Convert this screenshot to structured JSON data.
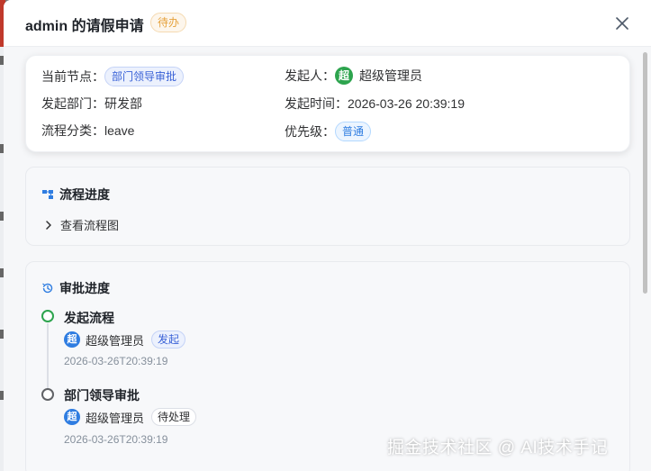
{
  "drawer": {
    "title": "admin 的请假申请",
    "status": "待办",
    "close_icon": "close-icon"
  },
  "info": {
    "node_label": "当前节点：",
    "node_value": "部门领导审批",
    "initiator_label": "发起人：",
    "initiator_avatar": "超",
    "initiator_name": "超级管理员",
    "dept_label": "发起部门：",
    "dept_value": "研发部",
    "time_label": "发起时间：",
    "time_value": "2026-03-26 20:39:19",
    "category_label": "流程分类：",
    "category_value": "leave",
    "priority_label": "优先级：",
    "priority_value": "普通"
  },
  "flow_progress": {
    "title": "流程进度",
    "icon": "flowchart-icon",
    "toggle_label": "查看流程图",
    "toggle_icon": "chevron-right-icon"
  },
  "approval_progress": {
    "title": "审批进度",
    "icon": "history-icon",
    "steps": [
      {
        "title": "发起流程",
        "avatar": "超",
        "user": "超级管理员",
        "tag": "发起",
        "time": "2026-03-26T20:39:19",
        "color": "#2da44e"
      },
      {
        "title": "部门领导审批",
        "avatar": "超",
        "user": "超级管理员",
        "tag": "待处理",
        "time": "2026-03-26T20:39:19",
        "color": "#606266"
      }
    ]
  },
  "watermark": "掘金技术社区 @ AI技术手记",
  "colors": {
    "primary": "#2f7de1",
    "success": "#2da44e",
    "warning": "#e6a23c"
  }
}
